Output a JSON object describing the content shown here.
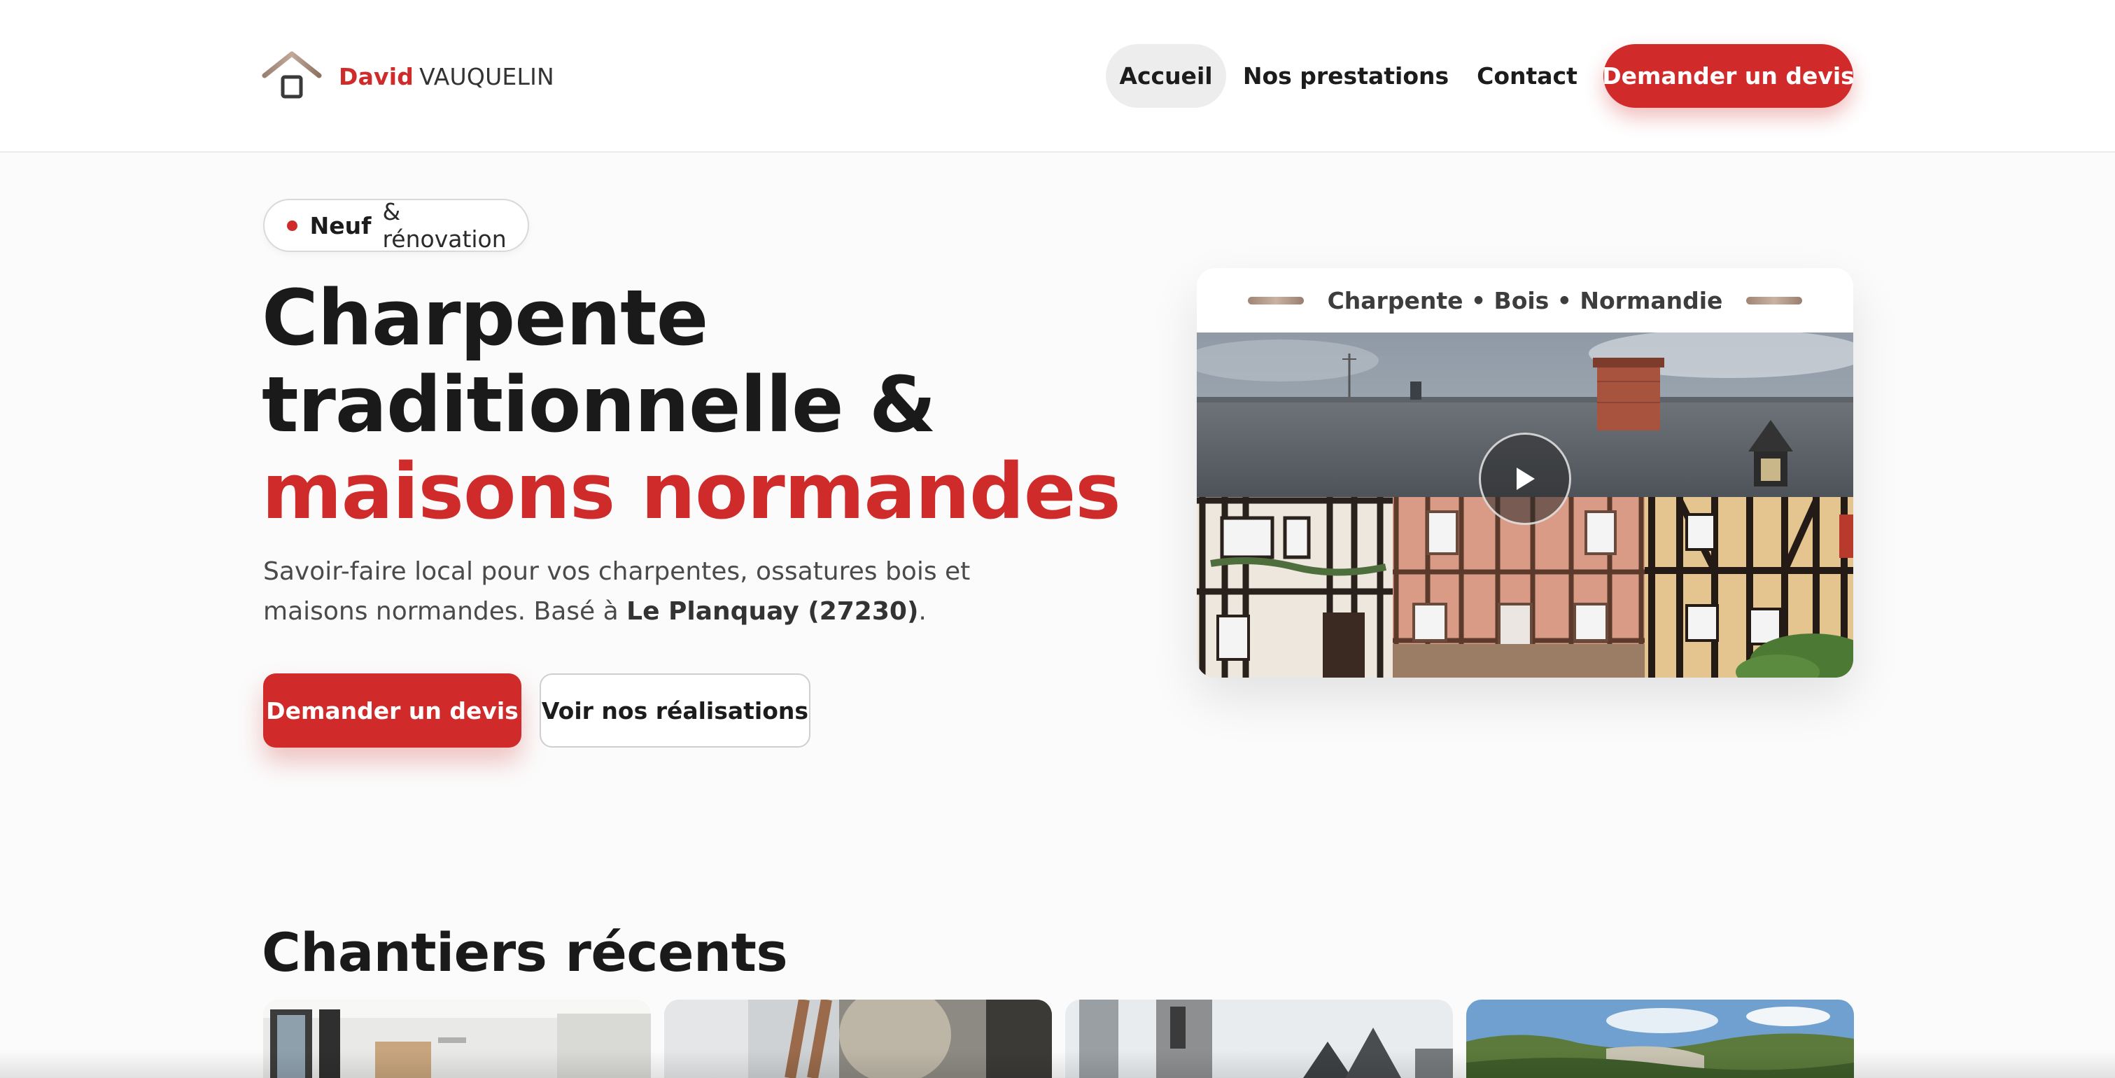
{
  "header": {
    "brand_first": "David",
    "brand_last": "VAUQUELIN",
    "logo_icon": "house-icon",
    "nav": {
      "home": "Accueil",
      "prestations": "Nos prestations",
      "contact": "Contact",
      "cta": "Demander un devis"
    },
    "active_nav": "Accueil"
  },
  "hero": {
    "badge_strong": "Neuf",
    "badge_rest": "& rénovation",
    "title_line1": "Charpente",
    "title_line2": "traditionnelle &",
    "title_line3": "maisons normandes",
    "desc_before": "Savoir-faire local pour vos charpentes, ossatures bois et maisons normandes. Basé à ",
    "desc_location": "Le Planquay (27230)",
    "desc_after": ".",
    "primary_button": "Demander un devis",
    "secondary_button": "Voir nos réalisations"
  },
  "card": {
    "caption": "Charpente • Bois • Normandie",
    "play_icon": "play-icon"
  },
  "recent": {
    "title": "Chantiers récents"
  },
  "colors": {
    "accent": "#cf2b2b",
    "text_dark": "#1a1a1a",
    "text_muted": "#4a4a4a",
    "nav_active_bg": "#ededed",
    "page_bg": "#fbfbfb"
  }
}
